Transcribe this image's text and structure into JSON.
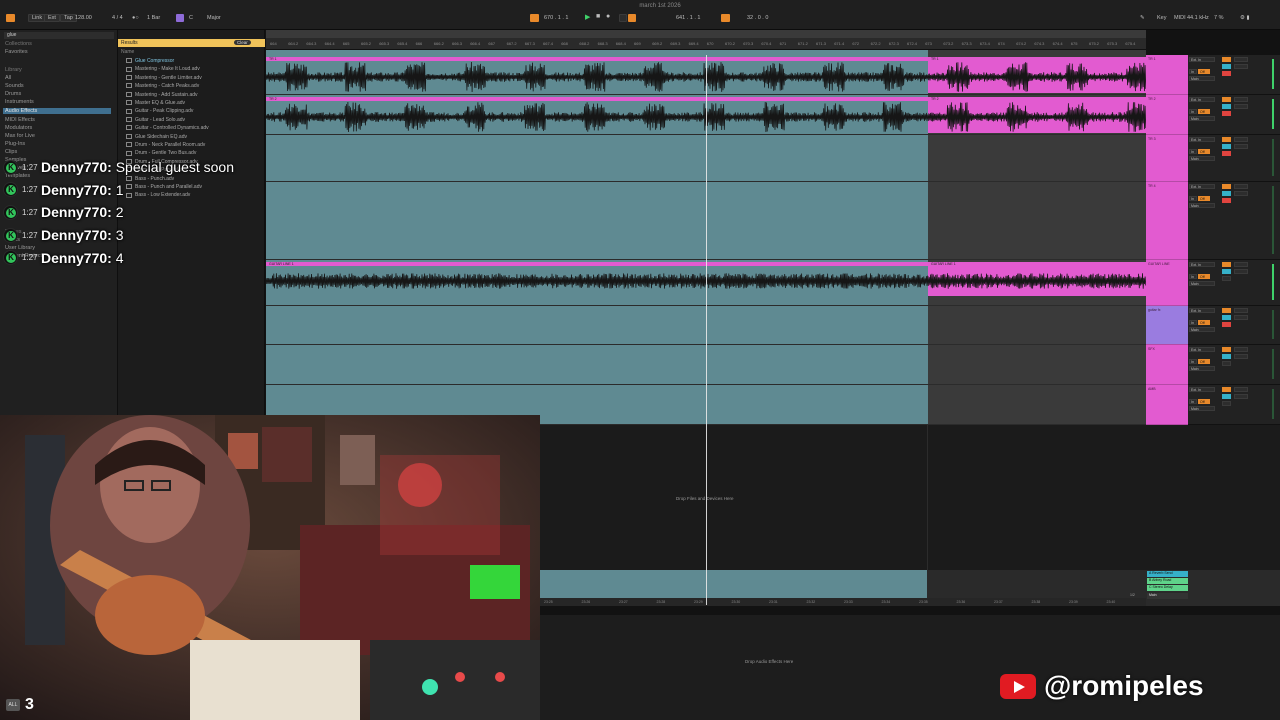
{
  "app": {
    "title": "march 1st 2026"
  },
  "transport": {
    "link": "Link",
    "ext": "Ext",
    "tap": "Tap",
    "tempo": "128.00",
    "time_sig": "4 / 4",
    "quant": "1 Bar",
    "key": "C",
    "scale": "Major",
    "position": "670 . 1 . 1",
    "loop_start": "641 . 1 . 1",
    "loop_length": "32 . 0 . 0",
    "key_label": "Key",
    "midi_label": "MIDI",
    "sample_rate": "44.1 kHz",
    "cpu": "7 %"
  },
  "browser": {
    "search_value": "glue",
    "collections_header": "Collections",
    "collections": [
      "Favorites"
    ],
    "library_header": "Library",
    "library": [
      "All",
      "Sounds",
      "Drums",
      "Instruments",
      "Audio Effects",
      "MIDI Effects",
      "Modulators",
      "Max for Live",
      "Plug-Ins",
      "Clips",
      "Samples",
      "Grooves",
      "Templates"
    ],
    "places_header": "Places",
    "places": [
      "Packs",
      "User Library",
      "Current Project"
    ],
    "results_header": "Results",
    "clear_label": "Clear",
    "results_root": "Name",
    "results": [
      "Glue Compressor",
      "Mastering - Make It Loud.adv",
      "Mastering - Gentle Limiter.adv",
      "Mastering - Catch Peaks.adv",
      "Mastering - Add Sustain.adv",
      "Master EQ & Glue.adv",
      "Guitar - Peak Clipping.adv",
      "Guitar - Lead Solo.adv",
      "Guitar - Controlled Dynamics.adv",
      "Glue Sidechain EQ.adv",
      "Drum - Neck Parallel Room.adv",
      "Drum - Gentle Two Bus.adv",
      "Drum - Full Compressor.adv",
      "Drum - Full Parallel.adv",
      "Bass - Punch.adv",
      "Bass - Punch and Parallel.adv",
      "Bass - Low Extender.adv"
    ]
  },
  "ruler": {
    "bars": [
      "664",
      "664.2",
      "664.3",
      "664.4",
      "665",
      "665.2",
      "665.3",
      "665.4",
      "666",
      "666.2",
      "666.3",
      "666.4",
      "667",
      "667.2",
      "667.3",
      "667.4",
      "668",
      "668.2",
      "668.3",
      "668.4",
      "669",
      "669.2",
      "669.3",
      "669.4",
      "670",
      "670.2",
      "670.3",
      "670.4",
      "671",
      "671.2",
      "671.3",
      "671.4",
      "672",
      "672.2",
      "672.3",
      "672.4",
      "673",
      "673.2",
      "673.3",
      "673.4",
      "674",
      "674.2",
      "674.3",
      "674.4",
      "675",
      "675.2",
      "675.3",
      "675.4"
    ],
    "time_marks": [
      "23:25",
      "23:26",
      "23:27",
      "23:28",
      "23:29",
      "23:30",
      "23:31",
      "23:32",
      "23:33",
      "23:34",
      "23:35",
      "23:36",
      "23:37",
      "23:38",
      "23:39",
      "23:40"
    ]
  },
  "tracks": [
    {
      "name": "TR 1",
      "clip_left": "TR 1",
      "clip_right": "TR 1"
    },
    {
      "name": "TR 2",
      "clip_left": "TR 2",
      "clip_right": "TR 2"
    },
    {
      "name": "TR 3"
    },
    {
      "name": "TR 4"
    },
    {
      "name": "GUITAR LINE",
      "clip_left": "GUITAR LINE 1",
      "clip_right": "GUITAR LINE 1"
    },
    {
      "name": "guitar fx"
    },
    {
      "name": "SFX"
    },
    {
      "name": "AMB"
    }
  ],
  "mixer": {
    "input": "Ext. In",
    "monitor_in": "In",
    "monitor_auto": "Auto",
    "monitor_off": "Off",
    "output": "Main",
    "returns": [
      "A Reverb Send",
      "B Abbey Road",
      "C Stereo Delay"
    ],
    "master": "Main",
    "master_ratio": "1/2"
  },
  "arrangement": {
    "drop_hint": "Drop Files and Devices Here",
    "devices_hint": "Drop Audio Effects Here"
  },
  "chat": [
    {
      "time": "1:27",
      "user": "Denny770:",
      "message": "Special guest soon"
    },
    {
      "time": "1:27",
      "user": "Denny770:",
      "message": "1"
    },
    {
      "time": "1:27",
      "user": "Denny770:",
      "message": "2"
    },
    {
      "time": "1:27",
      "user": "Denny770:",
      "message": "3"
    },
    {
      "time": "1:27",
      "user": "Denny770:",
      "message": "4"
    }
  ],
  "chat_badge": "K",
  "stream": {
    "viewers_icon": "ALL",
    "viewers": "3",
    "youtube_handle": "@romipeles"
  },
  "colors": {
    "clip_pink": "#e25bd0",
    "loop_teal": "#5f8a92",
    "accent_orange": "#e8892a",
    "meter_green": "#3fd26a",
    "youtube_red": "#e11b22"
  }
}
